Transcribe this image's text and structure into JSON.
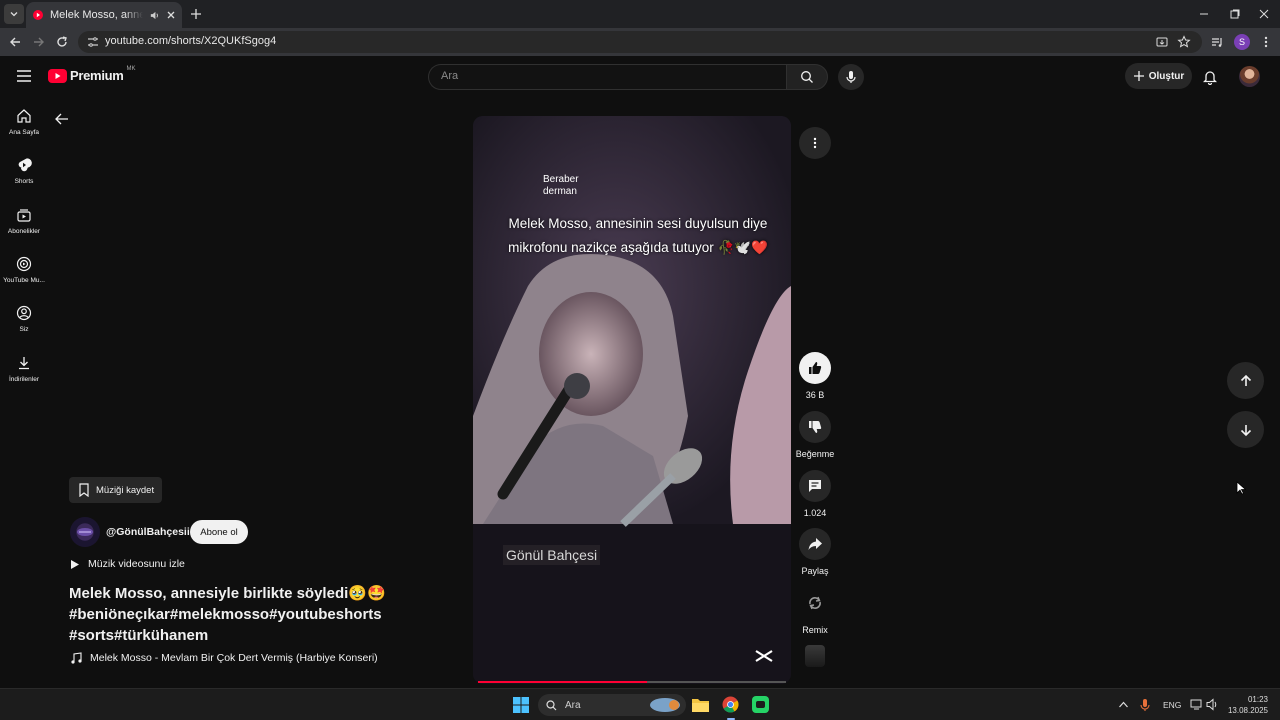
{
  "browser": {
    "tab_title": "Melek Mosso, annesiyle birlikte söyledi",
    "url": "youtube.com/shorts/X2QUKfSgog4",
    "profile_initial": "S"
  },
  "header": {
    "logo_text": "Premium",
    "logo_badge": "MK",
    "search_placeholder": "Ara",
    "create_label": "Oluştur"
  },
  "sidebar": {
    "items": [
      {
        "label": "Ana Sayfa",
        "icon": "home-icon"
      },
      {
        "label": "Shorts",
        "icon": "shorts-icon"
      },
      {
        "label": "Abonelikler",
        "icon": "subscriptions-icon"
      },
      {
        "label": "YouTube Mu...",
        "icon": "youtube-music-icon"
      },
      {
        "label": "Siz",
        "icon": "you-icon"
      },
      {
        "label": "İndirilenler",
        "icon": "downloads-icon"
      }
    ]
  },
  "video": {
    "overlay_small": [
      "Beraber",
      "derman"
    ],
    "caption_line1": "Melek Mosso, annesinin sesi duyulsun diye",
    "caption_line2": "mikrofonu nazikçe aşağıda tutuyor 🥀🕊️❤️",
    "watermark": "Gönül Bahçesi",
    "progress_fraction": 0.55
  },
  "actions": {
    "like_count": "36 B",
    "dislike_label": "Beğenme",
    "comment_count": "1.024",
    "share_label": "Paylaş",
    "remix_label": "Remix"
  },
  "info": {
    "save_music_label": "Müziği kaydet",
    "channel_name": "@GönülBahçesii",
    "subscribe_label": "Abone ol",
    "watch_video_label": "Müzik videosunu izle",
    "title": "Melek Mosso, annesiyle birlikte söyledi🥹🤩#beniöneçıkar#melekmosso#youtubeshorts#sorts#türkühanem",
    "track": "Melek Mosso - Mevlam Bir Çok Dert Vermiş (Harbiye Konseri)"
  },
  "taskbar": {
    "search_label": "Ara",
    "lang": "ENG",
    "time": "01:23",
    "date": "13.08.2025"
  },
  "colors": {
    "accent_red": "#ff0033",
    "background": "#0f0f0f",
    "chip": "#272727"
  }
}
